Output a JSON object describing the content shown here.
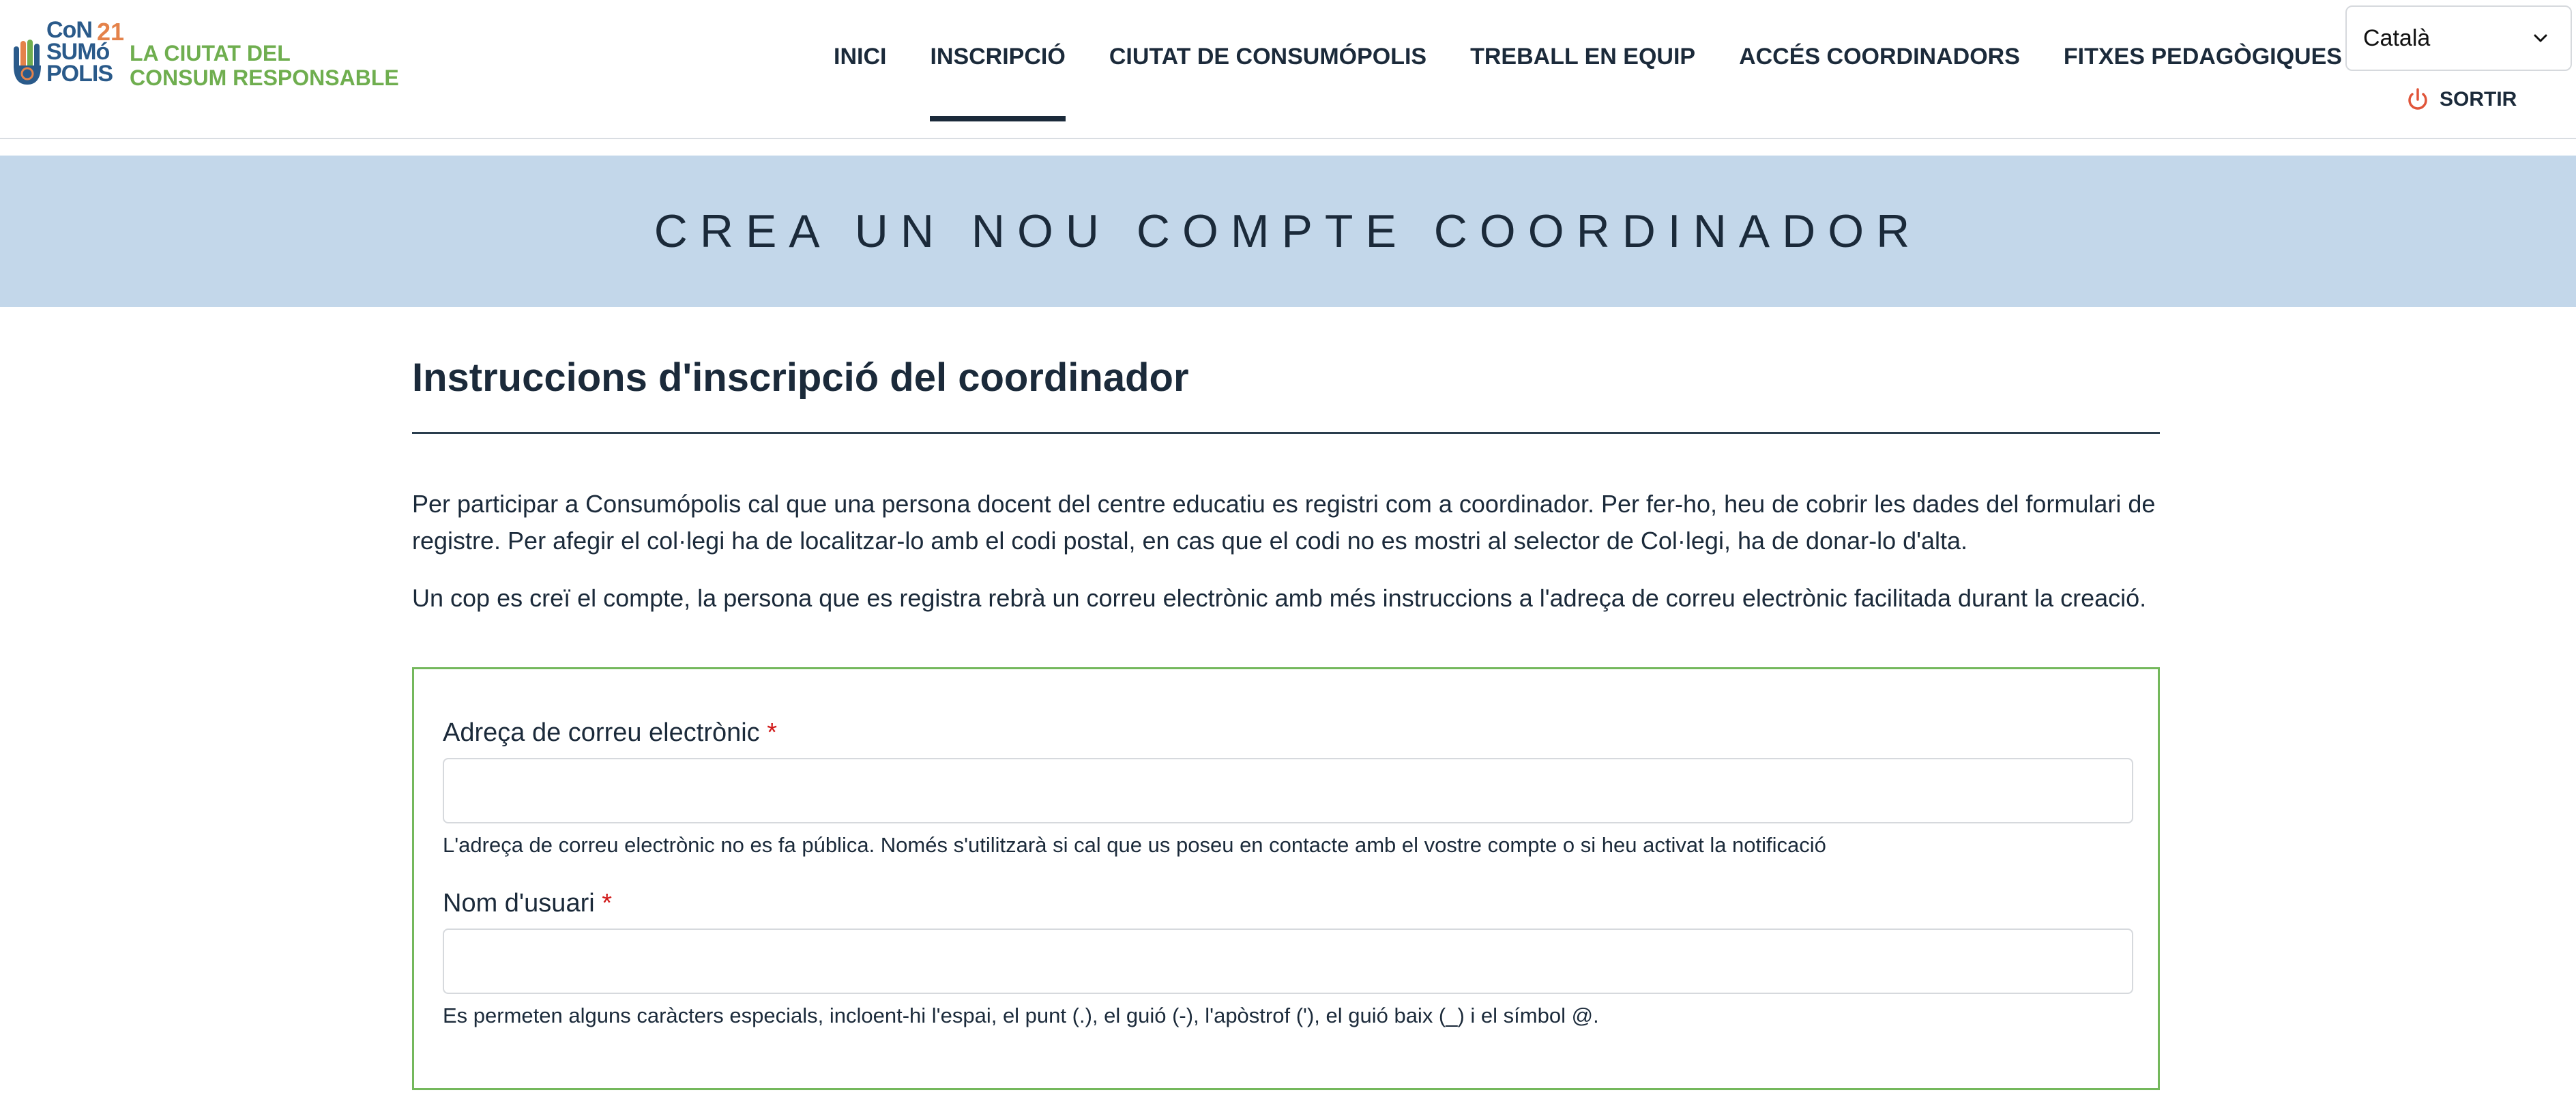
{
  "logo": {
    "line1": "CoN",
    "line2": "SUMó",
    "line3": "POLIS",
    "year": "21",
    "tagline_1": "LA CIUTAT DEL",
    "tagline_2": "CONSUM RESPONSABLE"
  },
  "nav": {
    "items": [
      {
        "label": "INICI"
      },
      {
        "label": "INSCRIPCIÓ",
        "active": true
      },
      {
        "label": "CIUTAT DE CONSUMÓPOLIS"
      },
      {
        "label": "TREBALL EN EQUIP"
      },
      {
        "label": "ACCÉS COORDINADORS"
      },
      {
        "label": "FITXES PEDAGÒGIQUES"
      }
    ]
  },
  "language": {
    "selected": "Català"
  },
  "logout": {
    "label": "SORTIR"
  },
  "banner": {
    "title": "CREA UN NOU COMPTE COORDINADOR"
  },
  "instructions": {
    "title": "Instruccions d'inscripció del coordinador",
    "paragraph_1": "Per participar a Consumópolis cal que una persona docent del centre educatiu es registri com a coordinador. Per fer-ho, heu de cobrir les dades del formulari de registre. Per afegir el col·legi ha de localitzar-lo amb el codi postal, en cas que el codi no es mostri al selector de Col·legi, ha de donar-lo d'alta.",
    "paragraph_2": "Un cop es creï el compte, la persona que es registra rebrà un correu electrònic amb més instruccions a l'adreça de correu electrònic facilitada durant la creació."
  },
  "form": {
    "email": {
      "label": "Adreça de correu electrònic",
      "required": "*",
      "value": "",
      "help": "L'adreça de correu electrònic no es fa pública. Només s'utilitzarà si cal que us poseu en contacte amb el vostre compte o si heu activat la notificació"
    },
    "username": {
      "label": "Nom d'usuari",
      "required": "*",
      "value": "",
      "help": "Es permeten alguns caràcters especials, incloent-hi l'espai, el punt (.), el guió (-), l'apòstrof ('), el guió baix (_) i el símbol @."
    }
  },
  "colors": {
    "navy": "#1b2a3a",
    "banner": "#c3d7ea",
    "form_border": "#74b85c",
    "required": "#d11a1a",
    "logout_icon": "#e0553a",
    "logo_blue": "#2a5a8a",
    "logo_green": "#6fae4f",
    "logo_orange": "#e4824a"
  }
}
